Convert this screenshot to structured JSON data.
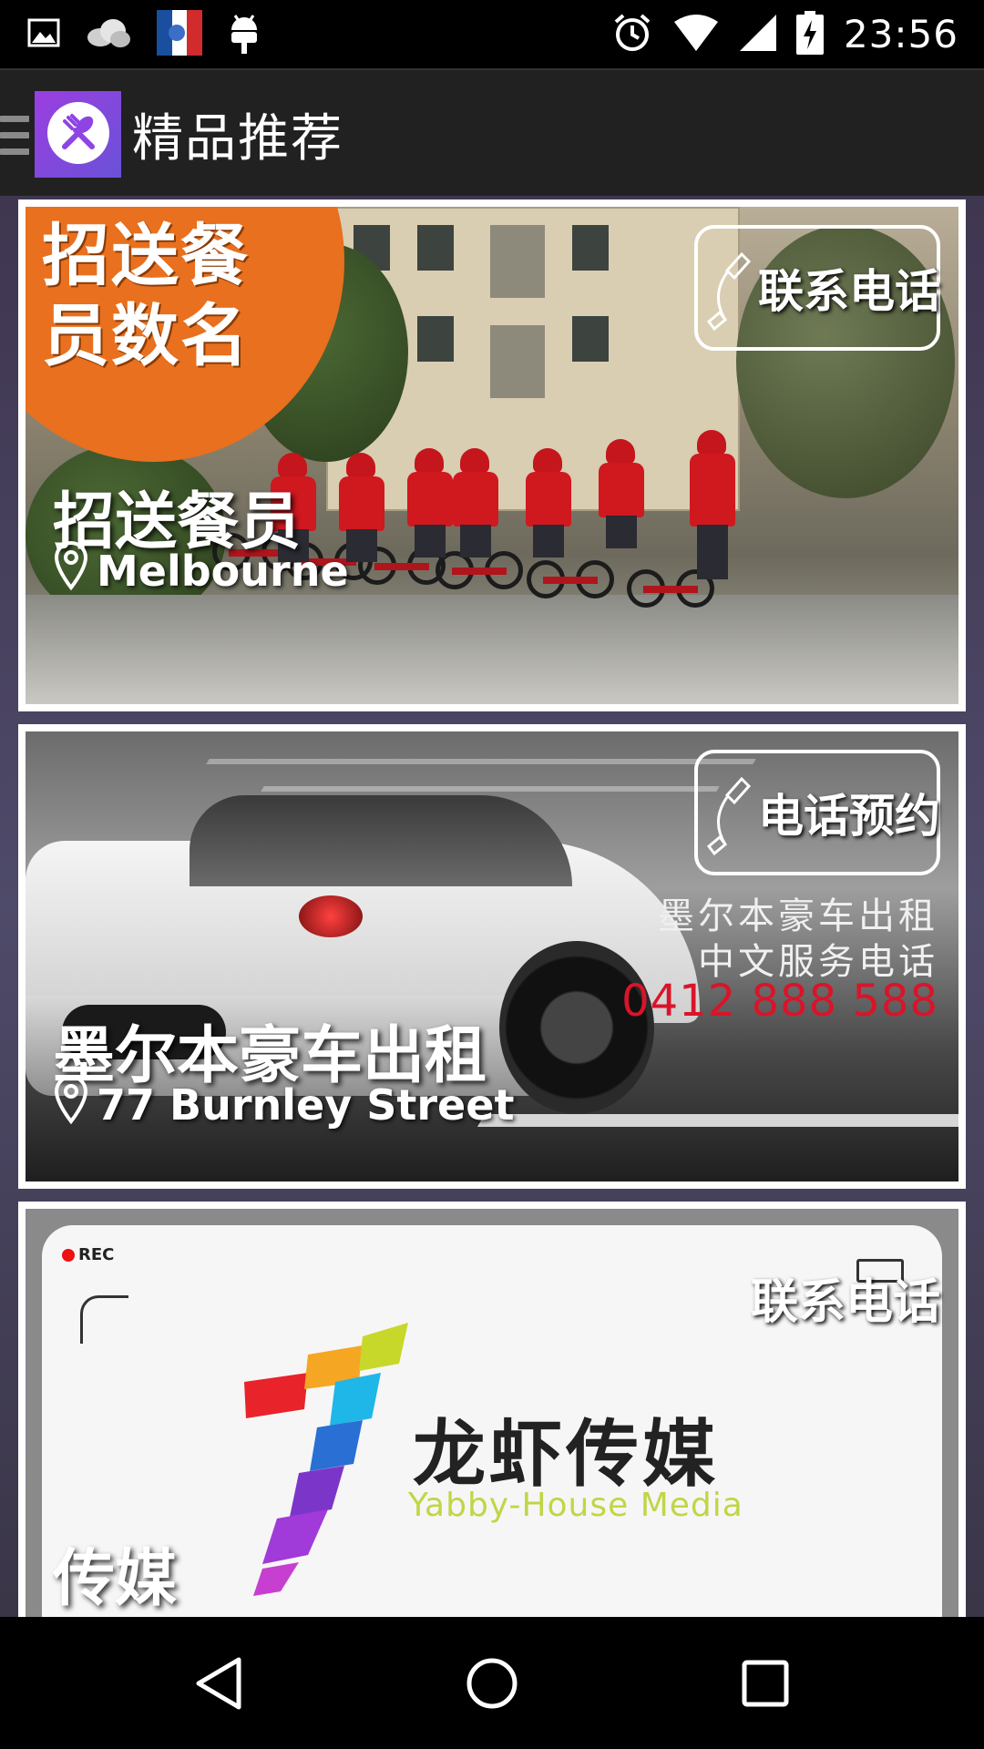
{
  "status_bar": {
    "time": "23:56",
    "icons": [
      "image-icon",
      "cloud-icon",
      "flag-icon",
      "android-icon",
      "alarm-icon",
      "wifi-icon",
      "signal-icon",
      "battery-icon"
    ]
  },
  "action_bar": {
    "title": "精品推荐",
    "logo_icon": "restaurant-icon",
    "accent": "#8e44e3"
  },
  "listings": [
    {
      "title": "招送餐员",
      "location": "Melbourne",
      "action_label": "联系电话",
      "banner_text": [
        "招送餐",
        "员数名"
      ],
      "banner_color": "#e8701e"
    },
    {
      "title": "墨尔本豪车出租",
      "location": "77 Burnley Street",
      "action_label": "电话预约",
      "ad_lines": [
        "墨尔本豪车出租",
        "中文服务电话",
        "0412 888 588"
      ],
      "ad_phone_color": "#d9142a"
    },
    {
      "title": "传媒",
      "action_label": "联系电话",
      "rec_label": "REC",
      "brand_cn": "龙虾传媒",
      "brand_en": "Yabby-House Media"
    }
  ],
  "nav_bar": {
    "buttons": [
      "back-icon",
      "home-icon",
      "recents-icon"
    ]
  }
}
